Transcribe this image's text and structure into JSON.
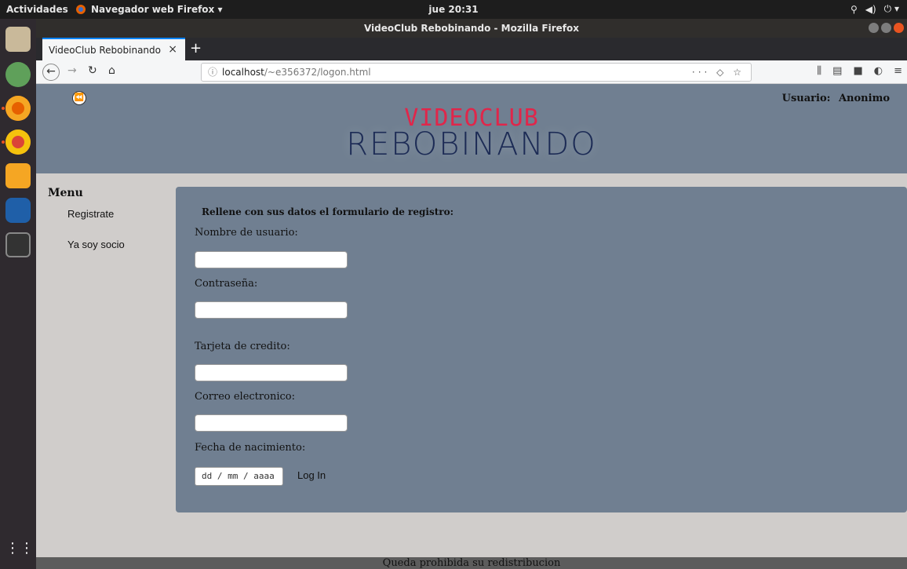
{
  "system": {
    "activities": "Actividades",
    "app_name": "Navegador web Firefox ▾",
    "clock": "jue 20:31"
  },
  "window": {
    "title": "VideoClub Rebobinando - Mozilla Firefox"
  },
  "browser": {
    "tab_title": "VideoClub Rebobinando",
    "url_host": "localhost",
    "url_path": "/~e356372/logon.html"
  },
  "header": {
    "user_label": "Usuario:",
    "user_name": "Anonimo",
    "logo_top": "VIDEOCLUB",
    "logo_bottom": "REBOBINANDO"
  },
  "menu": {
    "title": "Menu",
    "items": [
      "Registrate",
      "Ya soy socio"
    ]
  },
  "form": {
    "intro": "Rellene con sus datos el formulario de registro:",
    "username_label": "Nombre de usuario:",
    "password_label": "Contraseña:",
    "card_label": "Tarjeta de credito:",
    "email_label": "Correo electronico:",
    "birth_label": "Fecha de nacimiento:",
    "birth_placeholder": "dd / mm / aaaa",
    "submit_label": "Log In"
  },
  "footer": {
    "text": "Queda prohibida su redistribucion"
  },
  "colors": {
    "panel": "#707f91",
    "logo_red": "#e0264a",
    "logo_blue": "#1c2b55",
    "accent": "#e95420"
  }
}
